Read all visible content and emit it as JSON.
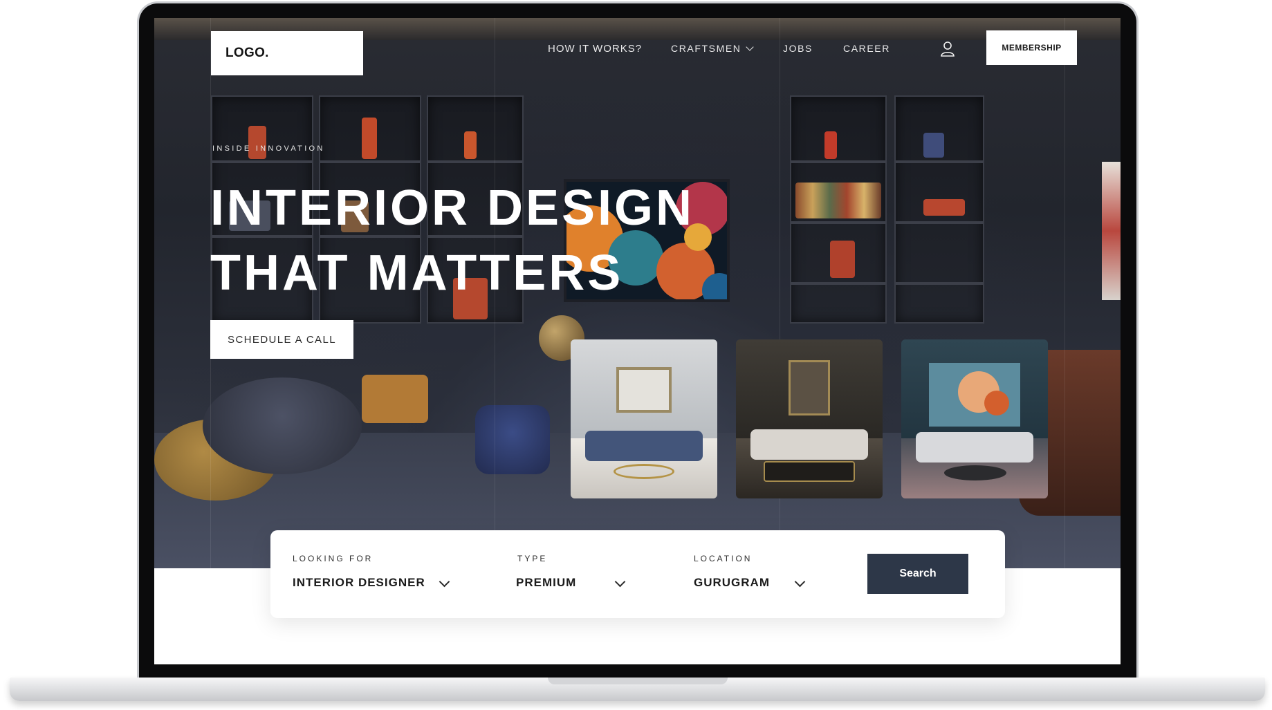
{
  "nav": {
    "logo": "LOGO.",
    "links": [
      {
        "label": "HOW IT WORKS?"
      },
      {
        "label": "CRAFTSMEN"
      },
      {
        "label": "JOBS"
      },
      {
        "label": "CAREER"
      }
    ],
    "membership_label": "MEMBERSHIP",
    "user_icon": "user-icon"
  },
  "hero": {
    "eyebrow": "INSIDE INNOVATION",
    "headline_line1": "INTERIOR DESIGN",
    "headline_line2": "THAT MATTERS",
    "cta_label": "SCHEDULE A CALL"
  },
  "search": {
    "fields": [
      {
        "label": "LOOKING FOR",
        "value": "INTERIOR DESIGNER"
      },
      {
        "label": "TYPE",
        "value": "PREMIUM"
      },
      {
        "label": "LOCATION",
        "value": "GURUGRAM"
      }
    ],
    "button_label": "Search"
  },
  "colors": {
    "accent": "#2d3748",
    "hero_bg": "#22252d",
    "white": "#ffffff"
  }
}
